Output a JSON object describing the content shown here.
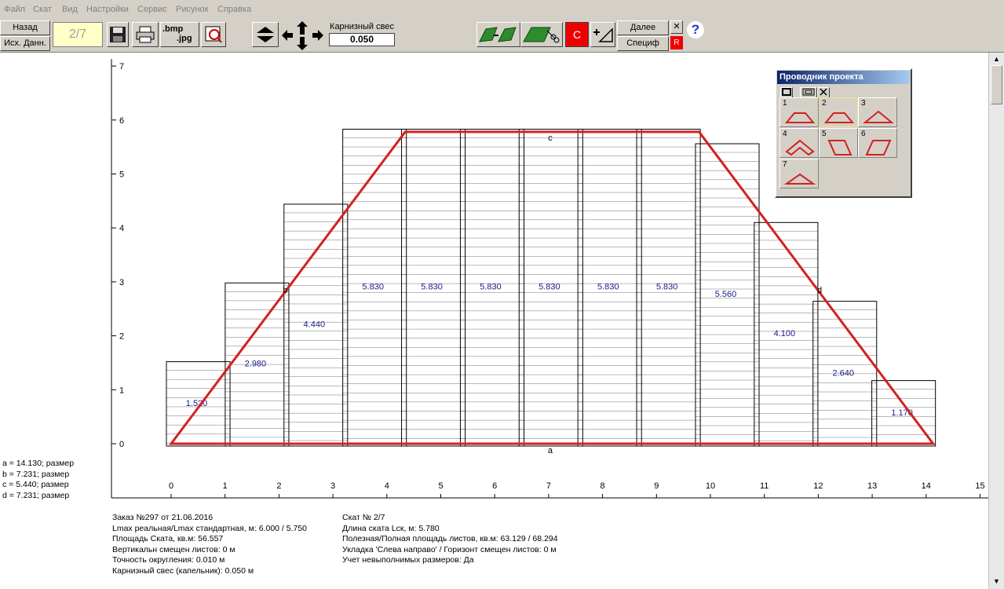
{
  "menu": [
    "Файл",
    "Скат",
    "Вид",
    "Настройки",
    "Сервис",
    "Рисунок",
    "Справка"
  ],
  "toolbar": {
    "back_label": "Назад",
    "source_label": "Исх. Данн.",
    "slope_counter": "2/7",
    "bmp_label_1": ".bmp",
    "bmp_label_2": ".jpg",
    "eaves_label": "Карнизный свес",
    "eaves_value": "0.050",
    "c_label": "C",
    "next_label": "Далее",
    "spec_label": "Специф",
    "r_label": "R",
    "close_symbol": "✕",
    "help_symbol": "?"
  },
  "dimensions": [
    "a = 14.130; размер",
    "b = 7.231; размер",
    "c = 5.440; размер",
    "d = 7.231; размер"
  ],
  "info_left": [
    "Заказ №297 от 21.06.2016",
    "Lmax реальная/Lmax стандартная, м: 6.000 / 5.750",
    "Площадь Ската, кв.м:  56.557",
    "Вертикальн смещен листов: 0 м",
    "Точность округления: 0.010 м",
    " Карнизный свес (капельник): 0.050 м"
  ],
  "info_right": [
    "Скат № 2/7",
    "Длина ската Lск, м: 5.780",
    "Полезная/Полная площадь листов, кв.м:  63.129 / 68.294",
    "Укладка 'Слева направо' / Горизонт смещен листов: 0 м",
    "Учет невыполнимых размеров: Да"
  ],
  "drawing": {
    "x_ticks": [
      "0",
      "1",
      "2",
      "3",
      "4",
      "5",
      "6",
      "7",
      "8",
      "9",
      "10",
      "11",
      "12",
      "13",
      "14",
      "15"
    ],
    "y_ticks": [
      "0",
      "1",
      "2",
      "3",
      "4",
      "5",
      "6",
      "7"
    ],
    "sheet_values": [
      1.52,
      2.98,
      4.44,
      5.83,
      5.83,
      5.83,
      5.83,
      5.83,
      5.83,
      5.56,
      4.1,
      2.64,
      1.17
    ],
    "sheet_labels": [
      "1.520",
      "2.980",
      "4.440",
      "5.830",
      "5.830",
      "5.830",
      "5.830",
      "5.830",
      "5.830",
      "5.560",
      "4.100",
      "2.640",
      "1.170"
    ],
    "sheet_x_starts": [
      0,
      1.09,
      2.18,
      3.27,
      4.36,
      5.45,
      6.54,
      7.63,
      8.72,
      9.81,
      10.9,
      11.99,
      13.08
    ],
    "sheet_width": 1.18,
    "trapezoid": [
      [
        0,
        0
      ],
      [
        4.34,
        5.78
      ],
      [
        9.79,
        5.78
      ],
      [
        14.13,
        0
      ]
    ],
    "edge_labels": {
      "a": "a",
      "b": "b",
      "c": "c",
      "d": "d"
    },
    "line_color": "#d42020",
    "label_color": "#1a1a8c"
  },
  "project_panel": {
    "title": "Проводник проекта",
    "items": [
      "1",
      "2",
      "3",
      "4",
      "5",
      "6",
      "7"
    ]
  }
}
